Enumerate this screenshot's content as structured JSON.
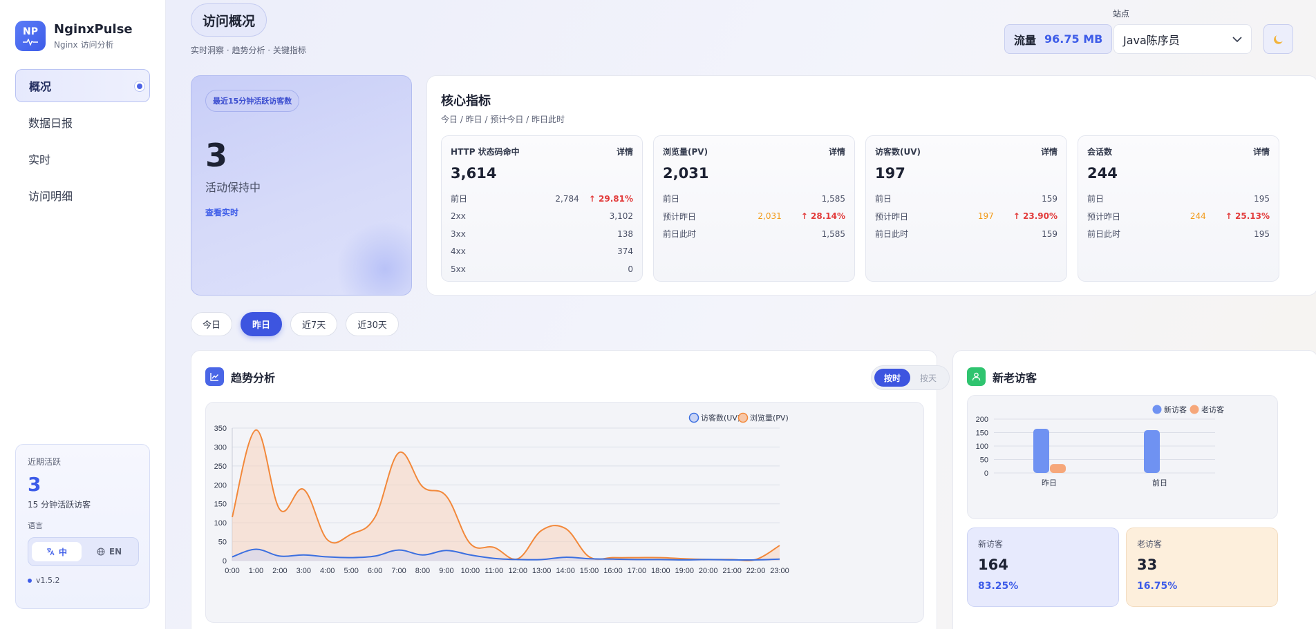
{
  "brand": {
    "logo_text": "NP",
    "name": "NginxPulse",
    "subtitle": "Nginx 访问分析"
  },
  "nav": [
    {
      "label": "概况",
      "active": true
    },
    {
      "label": "数据日报",
      "active": false
    },
    {
      "label": "实时",
      "active": false
    },
    {
      "label": "访问明细",
      "active": false
    }
  ],
  "recent": {
    "title": "近期活跃",
    "value": "3",
    "subtitle": "15 分钟活跃访客",
    "lang_label": "语言",
    "lang_zh": "中",
    "lang_en": "EN",
    "version": "v1.5.2"
  },
  "header": {
    "title": "访问概况",
    "subtitle": "实时洞察 · 趋势分析 · 关键指标"
  },
  "traffic": {
    "label": "流量",
    "value": "96.75 MB"
  },
  "site": {
    "label": "站点",
    "value": "Java陈序员"
  },
  "active_card": {
    "badge": "最近15分钟活跃访客数",
    "value": "3",
    "status": "活动保持中",
    "link": "查看实时"
  },
  "core": {
    "title": "核心指标",
    "subtitle": "今日 / 昨日 / 预计今日 / 昨日此时",
    "detail_label": "详情",
    "metrics": [
      {
        "title": "HTTP 状态码命中",
        "value": "3,614",
        "rows": [
          {
            "label": "前日",
            "mid": "2,784",
            "change": "↑ 29.81%"
          },
          {
            "label": "2xx",
            "value": "3,102"
          },
          {
            "label": "3xx",
            "value": "138"
          },
          {
            "label": "4xx",
            "value": "374"
          },
          {
            "label": "5xx",
            "value": "0"
          }
        ]
      },
      {
        "title": "浏览量(PV)",
        "value": "2,031",
        "rows": [
          {
            "label": "前日",
            "value": "1,585"
          },
          {
            "label": "预计昨日",
            "mid": "2,031",
            "change": "↑ 28.14%"
          },
          {
            "label": "前日此时",
            "value": "1,585"
          }
        ]
      },
      {
        "title": "访客数(UV)",
        "value": "197",
        "rows": [
          {
            "label": "前日",
            "value": "159"
          },
          {
            "label": "预计昨日",
            "mid": "197",
            "change": "↑ 23.90%"
          },
          {
            "label": "前日此时",
            "value": "159"
          }
        ]
      },
      {
        "title": "会话数",
        "value": "244",
        "rows": [
          {
            "label": "前日",
            "value": "195"
          },
          {
            "label": "预计昨日",
            "mid": "244",
            "change": "↑ 25.13%"
          },
          {
            "label": "前日此时",
            "value": "195"
          }
        ]
      }
    ]
  },
  "range_tabs": [
    {
      "label": "今日",
      "active": false
    },
    {
      "label": "昨日",
      "active": true
    },
    {
      "label": "近7天",
      "active": false
    },
    {
      "label": "近30天",
      "active": false
    }
  ],
  "trend": {
    "title": "趋势分析",
    "toggle_hour": "按时",
    "toggle_day": "按天"
  },
  "visitors": {
    "title": "新老访客",
    "new_label": "新访客",
    "new_value": "164",
    "new_pct": "83.25%",
    "old_label": "老访客",
    "old_value": "33",
    "old_pct": "16.75%"
  },
  "colors": {
    "accent": "#3d55e0",
    "uv": "#3b6fe0",
    "pv": "#f2883a",
    "new": "#6f92f2",
    "old": "#f6a77a"
  },
  "chart_data": [
    {
      "type": "area",
      "x": [
        "0:00",
        "1:00",
        "2:00",
        "3:00",
        "4:00",
        "5:00",
        "6:00",
        "7:00",
        "8:00",
        "9:00",
        "10:00",
        "11:00",
        "12:00",
        "13:00",
        "14:00",
        "15:00",
        "16:00",
        "17:00",
        "18:00",
        "19:00",
        "20:00",
        "21:00",
        "22:00",
        "23:00"
      ],
      "series": [
        {
          "name": "访客数(UV)",
          "values": [
            10,
            30,
            12,
            15,
            10,
            8,
            12,
            28,
            15,
            27,
            15,
            6,
            3,
            3,
            9,
            5,
            4,
            3,
            3,
            2,
            3,
            2,
            2,
            4
          ]
        },
        {
          "name": "浏览量(PV)",
          "values": [
            115,
            345,
            135,
            188,
            55,
            70,
            115,
            285,
            195,
            170,
            45,
            35,
            5,
            80,
            85,
            10,
            8,
            8,
            8,
            5,
            3,
            3,
            3,
            40
          ]
        }
      ],
      "ylim": [
        0,
        350
      ],
      "yticks": [
        0,
        50,
        100,
        150,
        200,
        250,
        300,
        350
      ],
      "grid": true,
      "legend": "top-right"
    },
    {
      "type": "bar",
      "categories": [
        "昨日",
        "前日"
      ],
      "series": [
        {
          "name": "新访客",
          "values": [
            164,
            159
          ]
        },
        {
          "name": "老访客",
          "values": [
            33,
            0
          ]
        }
      ],
      "ylim": [
        0,
        200
      ],
      "yticks": [
        0,
        50,
        100,
        150,
        200
      ],
      "grid": true,
      "legend": "top-right"
    }
  ]
}
